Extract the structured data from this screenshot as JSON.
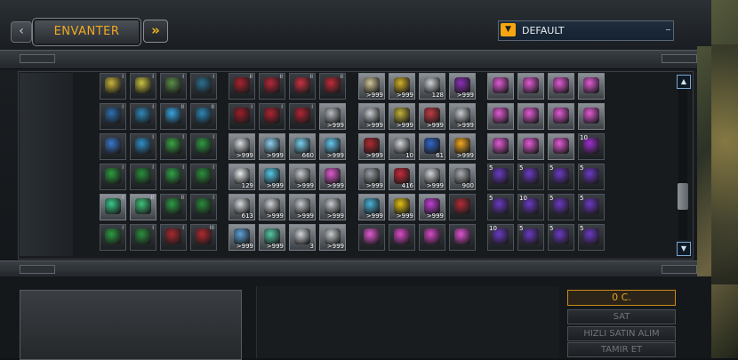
{
  "header": {
    "back_glyph": "‹",
    "tab_label": "ENVANTER",
    "forward_glyph": "»",
    "sort_icon": "chevron-down-icon",
    "sort_label": "DEFAULT"
  },
  "scroll": {
    "up_glyph": "▲",
    "down_glyph": "▼"
  },
  "footer": {
    "credits": "0 C.",
    "sell_label": "SAT",
    "quick_buy_label": "HIZLI SATIN ALIM",
    "repair_label": "TAMIR ET"
  },
  "watermark": "",
  "colors": {
    "accent": "#f2a822",
    "panel": "#181b1e",
    "scroll_border": "#7aa7d6"
  },
  "grid": {
    "group1": [
      [
        {
          "c": "#c9b43a",
          "t": "I"
        },
        {
          "c": "#c9c340",
          "t": "I"
        },
        {
          "c": "#5a8f4a",
          "t": "I"
        },
        {
          "c": "#2d6f8f",
          "t": "I"
        }
      ],
      [
        {
          "c": "#2d6fb0",
          "t": "I"
        },
        {
          "c": "#2f88b8",
          "t": "I"
        },
        {
          "c": "#3aa3e0",
          "t": "II"
        },
        {
          "c": "#2e86b6",
          "t": "II"
        }
      ],
      [
        {
          "c": "#3a77c9",
          "t": ""
        },
        {
          "c": "#2f8fc7",
          "t": "I"
        },
        {
          "c": "#3aa345",
          "t": "I"
        },
        {
          "c": "#2f9a43",
          "t": "I"
        }
      ],
      [
        {
          "c": "#2e9c3f",
          "t": "I"
        },
        {
          "c": "#2a8f3c",
          "t": "I"
        },
        {
          "c": "#31a248",
          "t": "I"
        },
        {
          "c": "#2c8f3d",
          "t": "I"
        }
      ],
      [
        {
          "c": "#38c98a",
          "t": "I",
          "light": true
        },
        {
          "c": "#3ec37a",
          "t": "II",
          "light": true
        },
        {
          "c": "#2e9b44",
          "t": "II"
        },
        {
          "c": "#2a8a3b",
          "t": "I"
        }
      ],
      [
        {
          "c": "#2e9b44",
          "t": "I"
        },
        {
          "c": "#2d8f3f",
          "t": "I"
        },
        {
          "c": "#a82a30",
          "t": "I"
        },
        {
          "c": "#b02a32",
          "t": "III"
        }
      ]
    ],
    "group2": [
      [
        {
          "c": "#a8232f",
          "t": "II"
        },
        {
          "c": "#b7283a",
          "t": "II"
        },
        {
          "c": "#c83244",
          "t": "II"
        },
        {
          "c": "#c22b3b",
          "t": "II"
        }
      ],
      [
        {
          "c": "#9b1f2a",
          "t": "I"
        },
        {
          "c": "#ad2433",
          "t": "I"
        },
        {
          "c": "#b02534",
          "t": "I"
        },
        {
          "c": "#b8bcc2",
          "q": ">999"
        }
      ],
      [
        {
          "c": "#d9dde2",
          "q": ">999"
        },
        {
          "c": "#8fd0ef",
          "q": ">999"
        },
        {
          "c": "#7ad0f0",
          "q": "660"
        },
        {
          "c": "#67c7ef",
          "q": ">999"
        }
      ],
      [
        {
          "c": "#e8ecef",
          "q": "129"
        },
        {
          "c": "#58c9e8",
          "q": ">999"
        },
        {
          "c": "#c8cdd2",
          "q": ">999"
        },
        {
          "c": "#e05bd1",
          "q": ">999"
        }
      ],
      [
        {
          "c": "#d7dbe0",
          "q": "613"
        },
        {
          "c": "#d0d4d9",
          "q": ">999"
        },
        {
          "c": "#c7cbd0",
          "q": ">999"
        },
        {
          "c": "#c7cbd0",
          "q": ">999"
        }
      ],
      [
        {
          "c": "#5fa3d8",
          "q": ">999"
        },
        {
          "c": "#56c8a6",
          "q": ">999"
        },
        {
          "c": "#d2d6da",
          "q": "3"
        },
        {
          "c": "#c9cdd1",
          "q": ">999"
        }
      ]
    ],
    "group3": [
      [
        {
          "c": "#d1c79a",
          "q": ">999"
        },
        {
          "c": "#d3b12a",
          "q": ">999"
        },
        {
          "c": "#cfd3d8",
          "q": "128"
        },
        {
          "c": "#8b2fb5",
          "q": ">999"
        }
      ],
      [
        {
          "c": "#c9cdd2",
          "q": ">999"
        },
        {
          "c": "#c3b23a",
          "q": ">999"
        },
        {
          "c": "#c23b45",
          "q": ">999"
        },
        {
          "c": "#c8ccd1",
          "q": ">999"
        }
      ],
      [
        {
          "c": "#b02a33",
          "q": ">999"
        },
        {
          "c": "#d2d6da",
          "q": "10"
        },
        {
          "c": "#3366c9",
          "q": "61"
        },
        {
          "c": "#f2a822",
          "q": ">999"
        }
      ],
      [
        {
          "c": "#9aa0a6",
          "q": ">999"
        },
        {
          "c": "#c62a3a",
          "q": "416"
        },
        {
          "c": "#d1d5da",
          "q": ">999"
        },
        {
          "c": "#a9adb2",
          "q": "900"
        }
      ],
      [
        {
          "c": "#4ab3d8",
          "q": ">999"
        },
        {
          "c": "#e3c214",
          "q": ">999"
        },
        {
          "c": "#c23fd6",
          "q": ">999"
        },
        {
          "c": "#b22d3a",
          "q": ""
        }
      ],
      [
        {
          "c": "#e25bd5",
          "q": ""
        },
        {
          "c": "#dc4ccc",
          "q": ""
        },
        {
          "c": "#d64ac8",
          "q": ""
        },
        {
          "c": "#e055d4",
          "q": ""
        }
      ]
    ],
    "group4": [
      [
        {
          "c": "#e25bd5",
          "q": "",
          "light": true
        },
        {
          "c": "#e25bd5",
          "q": "",
          "light": true
        },
        {
          "c": "#e25bd5",
          "q": "",
          "light": true
        },
        {
          "c": "#e25bd5",
          "q": "",
          "light": true
        }
      ],
      [
        {
          "c": "#e25bd5",
          "q": "",
          "light": true
        },
        {
          "c": "#e25bd5",
          "q": "",
          "light": true
        },
        {
          "c": "#e25bd5",
          "q": "",
          "light": true
        },
        {
          "c": "#e25bd5",
          "q": "",
          "light": true
        }
      ],
      [
        {
          "c": "#e25bd5",
          "q": "",
          "light": true
        },
        {
          "c": "#e25bd5",
          "q": "",
          "light": true
        },
        {
          "c": "#e25bd5",
          "q": "",
          "light": true
        },
        {
          "c": "#9d2fd0",
          "q": "",
          "l": "10"
        }
      ],
      [
        {
          "c": "#6a3ac2",
          "q": "",
          "l": "5"
        },
        {
          "c": "#6a3ac2",
          "q": "",
          "l": "5"
        },
        {
          "c": "#6a3ac2",
          "q": "",
          "l": "5"
        },
        {
          "c": "#6a3ac2",
          "q": "",
          "l": "5"
        }
      ],
      [
        {
          "c": "#6a3ac2",
          "q": "",
          "l": "5"
        },
        {
          "c": "#6a3ac2",
          "q": "",
          "l": "10"
        },
        {
          "c": "#6a3ac2",
          "q": "",
          "l": "5"
        },
        {
          "c": "#6a3ac2",
          "q": "",
          "l": "5"
        }
      ],
      [
        {
          "c": "#6a3ac2",
          "q": "",
          "l": "10"
        },
        {
          "c": "#6a3ac2",
          "q": "",
          "l": "5"
        },
        {
          "c": "#6a3ac2",
          "q": "",
          "l": "5"
        },
        {
          "c": "#6a3ac2",
          "q": "",
          "l": "5"
        }
      ]
    ]
  }
}
